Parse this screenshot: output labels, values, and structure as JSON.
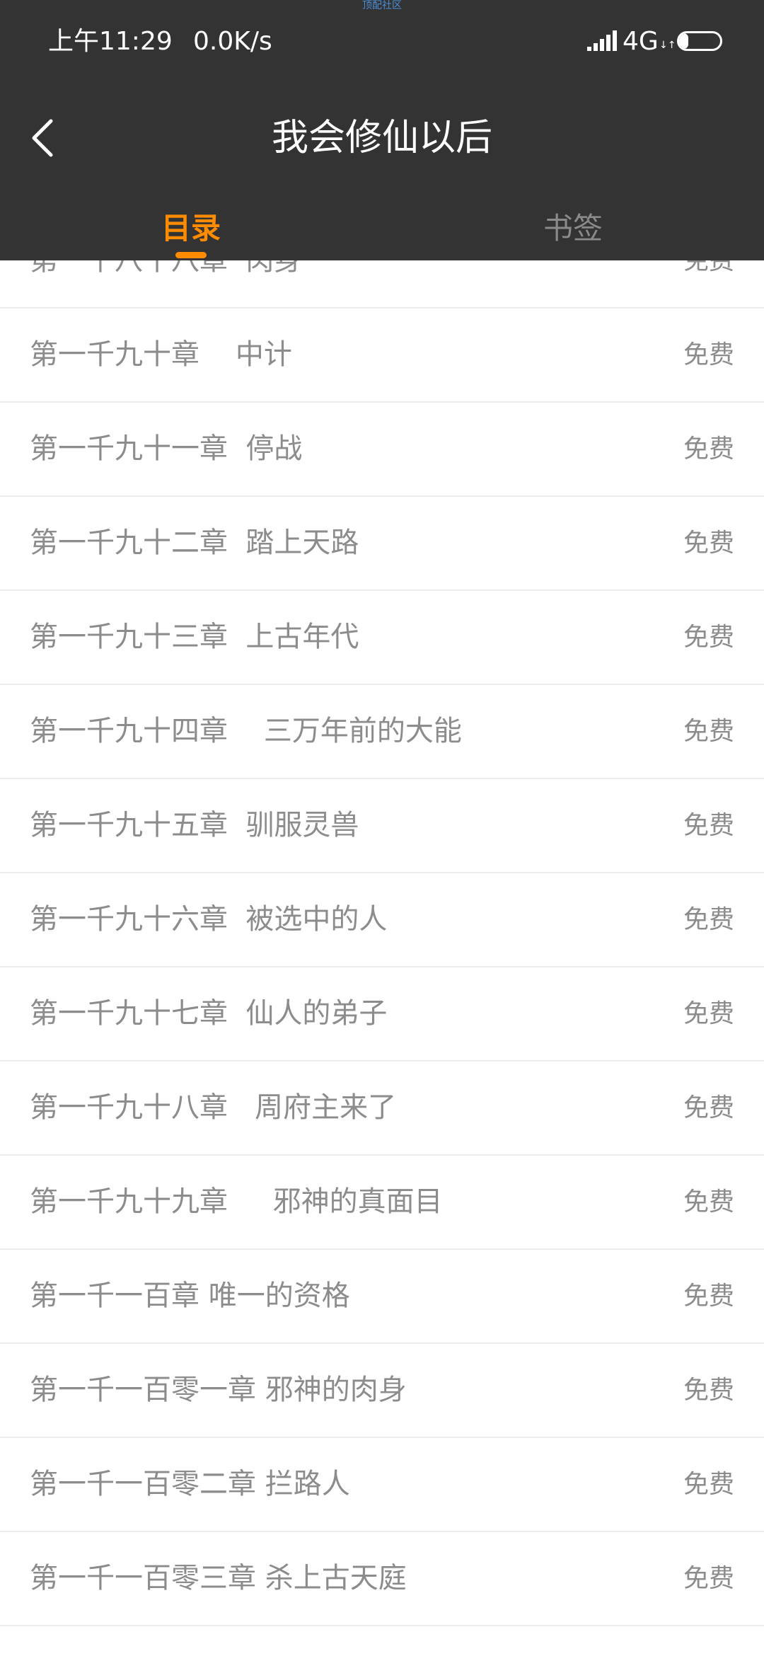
{
  "watermark": "顶配社区",
  "status_bar": {
    "time": "上午11:29",
    "net_speed": "0.0K/s",
    "network": "4G",
    "network_activity": "↓↑",
    "battery_level": 22,
    "battery_text": "22",
    "icons": [
      "signal-icon",
      "battery-icon"
    ]
  },
  "header": {
    "back_icon": "chevron-left-icon",
    "title": "我会修仙以后"
  },
  "tabs": [
    {
      "label": "目录",
      "active": true
    },
    {
      "label": "书签",
      "active": false
    }
  ],
  "colors": {
    "header_bg": "#333333",
    "accent": "#ff8c00",
    "text": "#8c8c8c",
    "divider": "#ececec"
  },
  "chapters": [
    {
      "title": "第一千八十八章  肉身",
      "price": "免费"
    },
    {
      "title": "第一千九十章    中计",
      "price": "免费"
    },
    {
      "title": "第一千九十一章  停战",
      "price": "免费"
    },
    {
      "title": "第一千九十二章  踏上天路",
      "price": "免费"
    },
    {
      "title": "第一千九十三章  上古年代",
      "price": "免费"
    },
    {
      "title": "第一千九十四章    三万年前的大能",
      "price": "免费"
    },
    {
      "title": "第一千九十五章  驯服灵兽",
      "price": "免费"
    },
    {
      "title": "第一千九十六章  被选中的人",
      "price": "免费"
    },
    {
      "title": "第一千九十七章  仙人的弟子",
      "price": "免费"
    },
    {
      "title": "第一千九十八章   周府主来了",
      "price": "免费"
    },
    {
      "title": "第一千九十九章     邪神的真面目",
      "price": "免费"
    },
    {
      "title": "第一千一百章 唯一的资格",
      "price": "免费"
    },
    {
      "title": "第一千一百零一章 邪神的肉身",
      "price": "免费"
    },
    {
      "title": "第一千一百零二章 拦路人",
      "price": "免费"
    },
    {
      "title": "第一千一百零三章 杀上古天庭",
      "price": "免费"
    }
  ]
}
